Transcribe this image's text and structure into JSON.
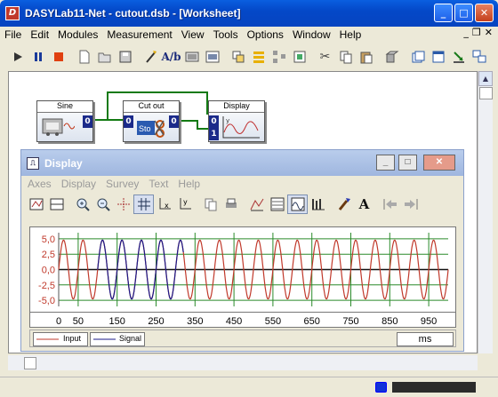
{
  "window": {
    "title": "DASYLab11-Net - cutout.dsb - [Worksheet]",
    "app_icon": "D",
    "btn_min": "_",
    "btn_max": "□",
    "btn_close": "✕",
    "btn_restore": "❐",
    "btn_inner_close": "✕"
  },
  "menu": [
    "File",
    "Edit",
    "Modules",
    "Measurement",
    "View",
    "Tools",
    "Options",
    "Window",
    "Help"
  ],
  "toolbar": {
    "icons": [
      "play-icon",
      "pause-icon",
      "stop-icon",
      "new-icon",
      "open-icon",
      "save-icon",
      "wizard-icon",
      "text-icon",
      "module-icon",
      "image-icon",
      "layers-icon",
      "list-icon",
      "network-icon",
      "copy-block-icon",
      "cut-icon",
      "copy-icon",
      "paste-icon",
      "3d-box-icon",
      "window-icon",
      "windows-icon",
      "export-icon",
      "multiwindow-icon"
    ]
  },
  "modules": {
    "sine": {
      "label": "Sine",
      "out": "0"
    },
    "cutout": {
      "label": "Cut out",
      "in": "0",
      "out": "0"
    },
    "display": {
      "label": "Display",
      "in0": "0",
      "in1": "1"
    }
  },
  "display_window": {
    "title": "Display",
    "menu": [
      "Axes",
      "Display",
      "Survey",
      "Text",
      "Help"
    ],
    "x_unit": "ms",
    "legend": [
      {
        "name": "Input",
        "color": "#c0392b"
      },
      {
        "name": "Signal",
        "color": "#1a1a8a"
      }
    ]
  },
  "chart_data": {
    "type": "line",
    "title": "",
    "xlabel": "",
    "ylabel": "",
    "x_unit": "ms",
    "xlim": [
      0,
      1000
    ],
    "ylim": [
      -6,
      6
    ],
    "x_ticks": [
      "0",
      "50",
      "150",
      "250",
      "350",
      "450",
      "550",
      "650",
      "750",
      "850",
      "950"
    ],
    "y_ticks": [
      "5,0",
      "2,5",
      "0,0",
      "-2,5",
      "-5,0"
    ],
    "grid": true,
    "series": [
      {
        "name": "Input",
        "color": "#c0392b",
        "amplitude": 4.8,
        "cycles_visible": 20,
        "x_range": [
          0,
          1000
        ]
      },
      {
        "name": "Signal",
        "color": "#1a1a8a",
        "amplitude": 4.8,
        "cycles_visible": 3,
        "x_range": [
          100,
          320
        ]
      }
    ]
  },
  "status": {
    "led_color": "#1030d8"
  }
}
